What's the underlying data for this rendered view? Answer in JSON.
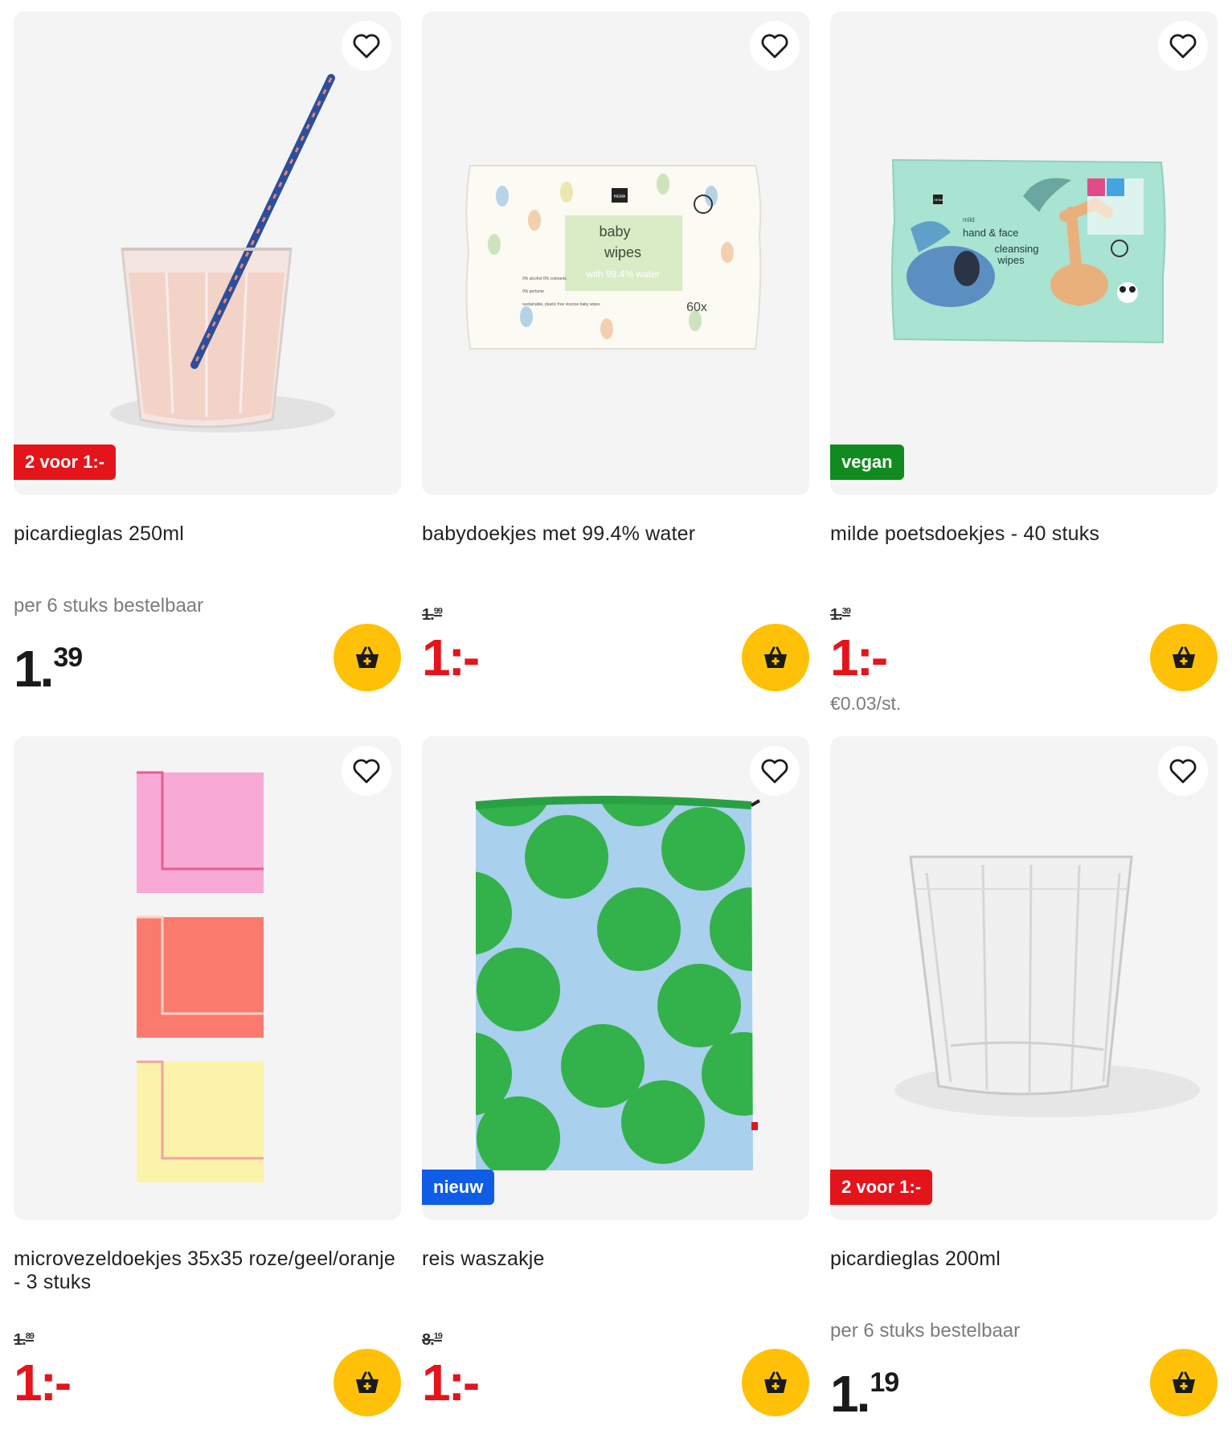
{
  "products": [
    {
      "title": "picardieglas 250ml",
      "badge": "2 voor 1:-",
      "badge_color": "#e4141b",
      "note": "per 6 stuks bestelbaar",
      "price_main": "1.",
      "price_cents": "39",
      "price_color": "black",
      "icon": "glass-with-straw-image"
    },
    {
      "title": "babydoekjes met 99.4% water",
      "old_price_main": "1.",
      "old_price_cents": "99",
      "price_main": "1:-",
      "price_color": "red",
      "icon": "baby-wipes-package-image",
      "pack_text": {
        "brand": "HEMA",
        "line1": "baby",
        "line2": "wipes",
        "line3": "with 99.4% water",
        "count": "60x",
        "features": [
          "0% alcohol 0% colorants",
          "0% perfume",
          "sustainable, plastic free viscose baby wipes"
        ]
      }
    },
    {
      "title": "milde poetsdoekjes - 40 stuks",
      "badge": "vegan",
      "badge_color": "#118a1f",
      "old_price_main": "1.",
      "old_price_cents": "39",
      "price_main": "1:-",
      "price_color": "red",
      "unit_price": "€0.03/st.",
      "icon": "face-wipes-package-image",
      "pack_text": {
        "brand": "HEMA",
        "line0": "mild",
        "line1": "hand & face",
        "line2": "cleansing",
        "line3": "wipes"
      }
    },
    {
      "title": "microvezeldoekjes 35x35 roze/geel/oranje - 3 stuks",
      "old_price_main": "1.",
      "old_price_cents": "89",
      "price_main": "1:-",
      "price_color": "red",
      "icon": "microfiber-cloths-image"
    },
    {
      "title": "reis waszakje",
      "badge": "nieuw",
      "badge_color": "#0f5ce6",
      "old_price_main": "8.",
      "old_price_cents": "19",
      "price_main": "1:-",
      "price_color": "red",
      "icon": "dotted-laundry-bag-image"
    },
    {
      "title": "picardieglas 200ml",
      "badge": "2 voor 1:-",
      "badge_color": "#e4141b",
      "note": "per 6 stuks bestelbaar",
      "price_main": "1.",
      "price_cents": "19",
      "price_color": "black",
      "icon": "empty-glass-image"
    }
  ],
  "colors": {
    "accent_red": "#e4141b",
    "cart_yellow": "#ffc107",
    "tile_bg": "#f4f4f4"
  }
}
